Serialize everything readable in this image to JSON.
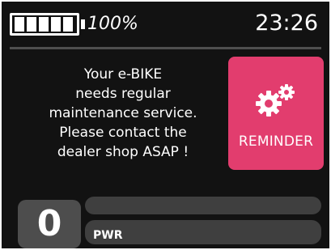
{
  "status_bar": {
    "battery_level_percent": 100,
    "battery_cells_filled": 5,
    "battery_text": "100%",
    "clock": "23:26"
  },
  "message": {
    "lines": [
      "Your e-BIKE",
      "needs regular",
      "maintenance service.",
      "Please contact the",
      "dealer shop ASAP !"
    ]
  },
  "reminder": {
    "icon": "gears-icon",
    "label": "REMINDER",
    "color": "#e23d6e"
  },
  "speed": {
    "value": "0"
  },
  "power": {
    "label": "PWR"
  }
}
